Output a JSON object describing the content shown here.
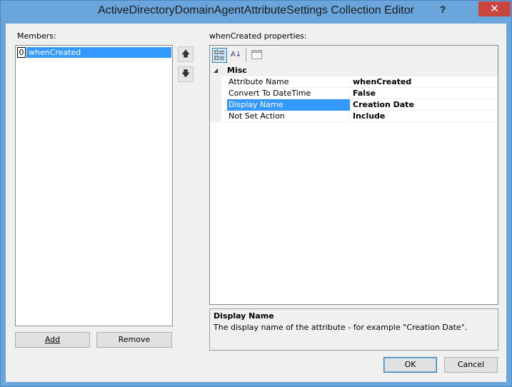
{
  "window": {
    "title": "ActiveDirectoryDomainAgentAttributeSettings Collection Editor",
    "help_glyph": "?",
    "close_glyph": "✕"
  },
  "members": {
    "label": "Members:",
    "items": [
      {
        "index": "0",
        "name": "whenCreated",
        "selected": true
      }
    ],
    "add_label": "Add",
    "remove_label": "Remove",
    "move_up_glyph": "🡅",
    "move_down_glyph": "🡇"
  },
  "properties": {
    "label": "whenCreated properties:",
    "toolbar": {
      "categorized_icon": "categorized-icon",
      "alphabetical_icon": "alphabetical-icon",
      "alphabetical_glyph": "A↓",
      "property_pages_icon": "property-pages-icon"
    },
    "category": "Misc",
    "rows": [
      {
        "name": "Attribute Name",
        "value": "whenCreated"
      },
      {
        "name": "Convert To DateTime",
        "value": "False"
      },
      {
        "name": "Display Name",
        "value": "Creation Date",
        "selected": true
      },
      {
        "name": "Not Set Action",
        "value": "Include"
      }
    ]
  },
  "description": {
    "title": "Display Name",
    "text": "The display name of the attribute - for example \"Creation Date\"."
  },
  "footer": {
    "ok_label": "OK",
    "cancel_label": "Cancel"
  },
  "colors": {
    "titlebar": "#6aa6dc",
    "selection": "#3399ff",
    "close_button": "#c7463f"
  }
}
